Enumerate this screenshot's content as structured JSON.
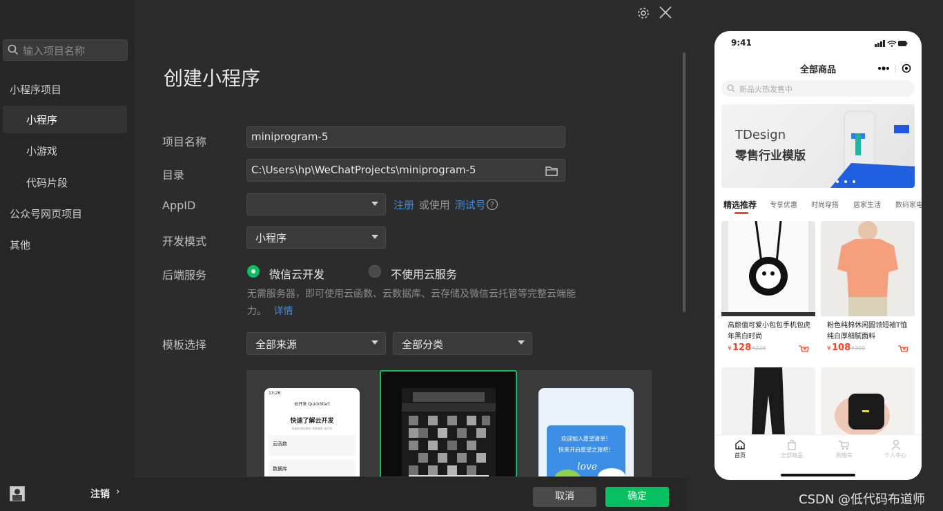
{
  "sidebar": {
    "search_placeholder": "输入项目名称",
    "items": [
      {
        "label": "小程序项目"
      },
      {
        "label": "小程序"
      },
      {
        "label": "小游戏"
      },
      {
        "label": "代码片段"
      },
      {
        "label": "公众号网页项目"
      },
      {
        "label": "其他"
      }
    ],
    "logout_label": "注销",
    "logout_chevron": "›"
  },
  "main": {
    "title": "创建小程序",
    "form": {
      "name_label": "项目名称",
      "name_value": "miniprogram-5",
      "dir_label": "目录",
      "dir_value": "C:\\Users\\hp\\WeChatProjects\\miniprogram-5",
      "appid_label": "AppID",
      "appid_value": "",
      "register_link": "注册",
      "or_use_text": "或使用",
      "test_account_link": "测试号",
      "devmode_label": "开发模式",
      "devmode_value": "小程序",
      "backend_label": "后端服务",
      "backend_option_1": "微信云开发",
      "backend_option_2": "不使用云服务",
      "backend_selected": "微信云开发",
      "backend_desc": "无需服务器，即可使用云函数、云数据库、云存储及微信云托管等完整云端能力。",
      "details_link": "详情",
      "template_label": "模板选择",
      "source_select": "全部来源",
      "category_select": "全部分类"
    },
    "templates": [
      {
        "header": "云开发 QuickStart",
        "time": "13:26",
        "heading": "快速了解云开发",
        "sub": "免鉴权调用微信 免数据库 离开发",
        "items": [
          "云函数",
          "数据库"
        ]
      },
      {
        "selected": true
      },
      {
        "banner_line1": "欢迎加入愿望清单！",
        "banner_line2": "快来开启愿望之旅吧！",
        "script": "love"
      }
    ],
    "cancel_button": "取消",
    "ok_button": "确定"
  },
  "preview": {
    "time": "9:41",
    "title": "全部商品",
    "search_placeholder": "新品火热发售中",
    "banner_line1": "TDesign",
    "banner_line2": "零售行业模版",
    "tabs": [
      "精选推荐",
      "专享优惠",
      "时尚穿搭",
      "居家生活",
      "数码家电"
    ],
    "active_tab": "精选推荐",
    "products": [
      {
        "title": "高颜值可爱小包包手机包虎年黑白时尚",
        "price": "128",
        "original": "¥228"
      },
      {
        "title": "粉色纯棉休闲圆领短袖T恤纯白厚细腻面料",
        "price": "108",
        "original": "¥399"
      }
    ],
    "currency": "¥",
    "nav": [
      "首页",
      "全部商品",
      "购物车",
      "个人中心"
    ]
  },
  "watermark": "CSDN @低代码布道师",
  "colors": {
    "accent_green": "#07c160",
    "link_blue": "#3b8fe6",
    "price_red": "#fa4126"
  }
}
